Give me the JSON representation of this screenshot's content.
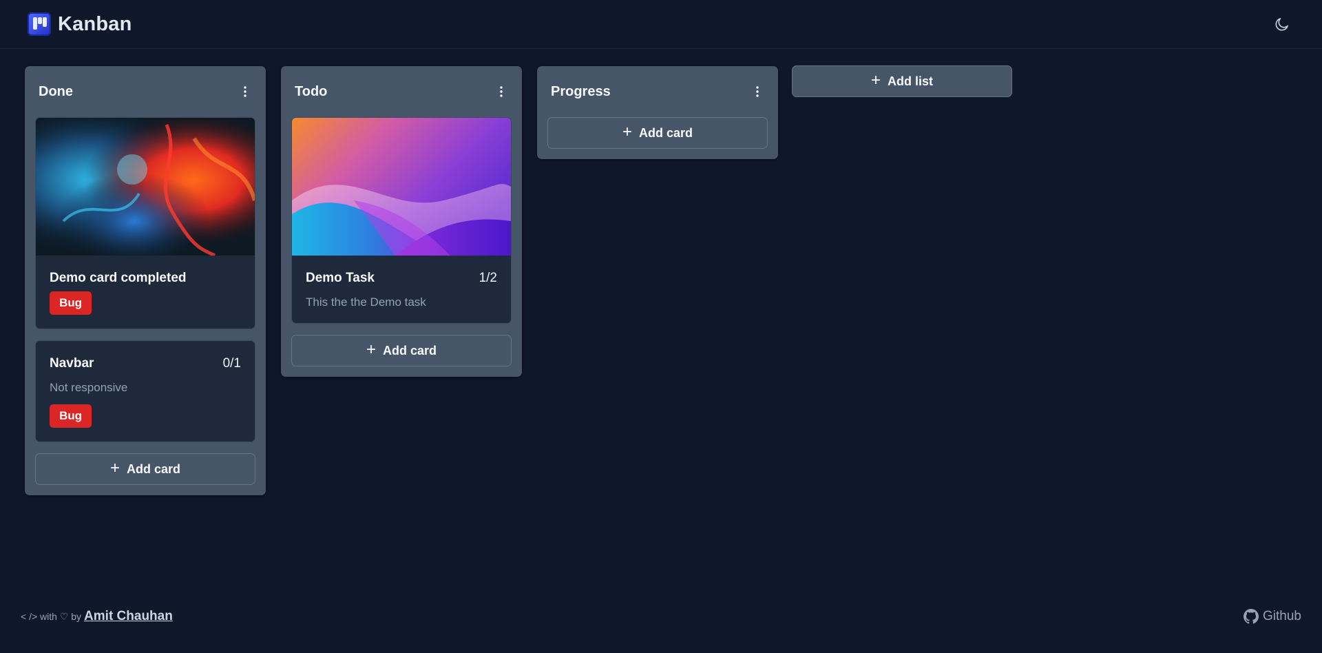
{
  "header": {
    "title": "Kanban",
    "logo_icon": "kanban-board-icon",
    "theme_icon": "moon-icon"
  },
  "lists": [
    {
      "title": "Done",
      "menu_icon": "more-vertical-icon",
      "cards": [
        {
          "title": "Demo card completed",
          "tag": "Bug",
          "image": "colorful-smoke-image"
        },
        {
          "title": "Navbar",
          "count": "0/1",
          "description": "Not responsive",
          "tag": "Bug"
        }
      ],
      "add_card_label": "Add card"
    },
    {
      "title": "Todo",
      "menu_icon": "more-vertical-icon",
      "cards": [
        {
          "title": "Demo Task",
          "count": "1/2",
          "description": "This the the Demo task",
          "image": "purple-waves-image"
        }
      ],
      "add_card_label": "Add card"
    },
    {
      "title": "Progress",
      "menu_icon": "more-vertical-icon",
      "cards": [],
      "add_card_label": "Add card"
    }
  ],
  "add_list_label": "Add list",
  "footer": {
    "credit_prefix": "< /> with ♡ by",
    "author": "Amit Chauhan",
    "github_label": "Github"
  },
  "colors": {
    "background": "#0f172a",
    "list": "#475569",
    "card": "#1e293b",
    "tag_bug": "#dc2626",
    "logo": "#3b4ef0"
  }
}
